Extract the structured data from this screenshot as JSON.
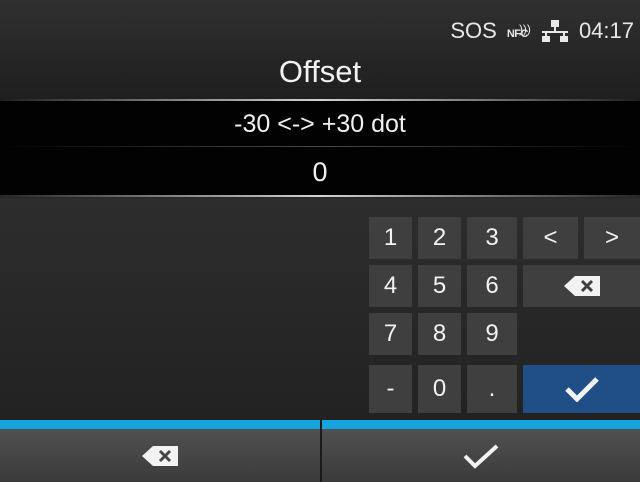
{
  "status_bar": {
    "sos_label": "SOS",
    "nfc_label": "NFC",
    "time": "04:17",
    "icons": [
      "nfc-icon",
      "network-icon"
    ]
  },
  "screen": {
    "title": "Offset",
    "range": "-30 <-> +30 dot",
    "value": "0"
  },
  "keypad": {
    "keys": [
      "1",
      "2",
      "3",
      "4",
      "5",
      "6",
      "7",
      "8",
      "9",
      "-",
      "0",
      "."
    ],
    "left_label": "<",
    "right_label": ">",
    "icons": [
      "backspace-icon",
      "check-icon"
    ]
  },
  "bottom_bar": {
    "icons": [
      "backspace-icon",
      "check-icon"
    ]
  },
  "colors": {
    "accent_blue": "#16a4e0",
    "ok_key": "#1f4f86",
    "key_bg": "#3f3f3f",
    "background": "#262626"
  }
}
